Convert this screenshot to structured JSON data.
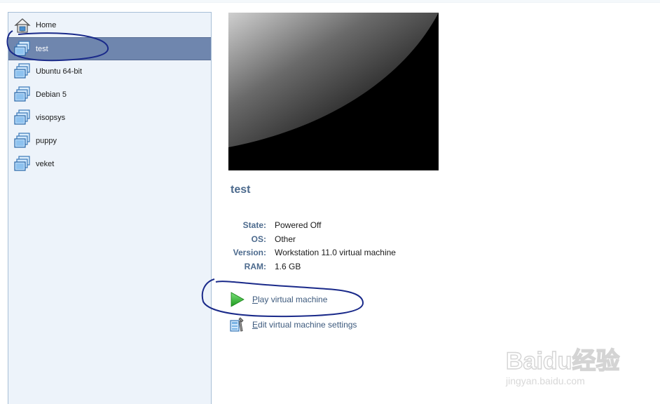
{
  "sidebar": {
    "items": [
      {
        "label": "Home",
        "icon": "home-icon"
      },
      {
        "label": "test",
        "icon": "vm-icon",
        "selected": true
      },
      {
        "label": "Ubuntu 64-bit",
        "icon": "vm-icon"
      },
      {
        "label": "Debian 5",
        "icon": "vm-icon"
      },
      {
        "label": "visopsys",
        "icon": "vm-icon"
      },
      {
        "label": "puppy",
        "icon": "vm-icon"
      },
      {
        "label": "veket",
        "icon": "vm-icon"
      }
    ]
  },
  "vm": {
    "name": "test",
    "details": [
      {
        "key": "State:",
        "value": "Powered Off"
      },
      {
        "key": "OS:",
        "value": "Other"
      },
      {
        "key": "Version:",
        "value": "Workstation 11.0 virtual machine"
      },
      {
        "key": "RAM:",
        "value": "1.6 GB"
      }
    ]
  },
  "actions": {
    "play": {
      "first": "P",
      "rest": "lay virtual machine"
    },
    "edit": {
      "first": "E",
      "rest": "dit virtual machine settings"
    }
  },
  "watermark": {
    "text": "Baidu经验",
    "url": "jingyan.baidu.com"
  },
  "colors": {
    "selection": "#6f86ae",
    "label_blue": "#4c6a8d",
    "annotation_ink": "#1a2a8a",
    "play_green": "#2db32d"
  }
}
